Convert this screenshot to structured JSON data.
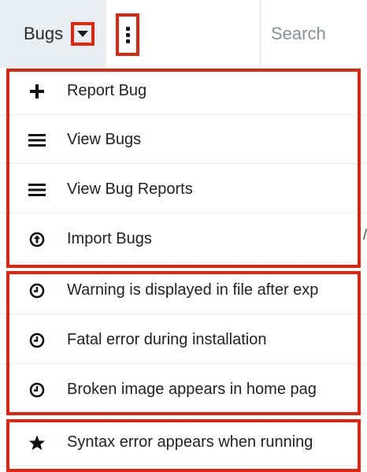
{
  "navbar": {
    "module_label": "Bugs",
    "search_placeholder": "Search"
  },
  "menu": {
    "actions": [
      {
        "label": "Report Bug",
        "icon": "plus-icon"
      },
      {
        "label": "View Bugs",
        "icon": "list-icon"
      },
      {
        "label": "View Bug Reports",
        "icon": "list-icon"
      },
      {
        "label": "Import Bugs",
        "icon": "upload-circle-icon"
      }
    ],
    "recently_viewed": [
      {
        "label": "Warning is displayed in file after exp",
        "icon": "clock-icon"
      },
      {
        "label": "Fatal error during installation",
        "icon": "clock-icon"
      },
      {
        "label": "Broken image appears in home pag",
        "icon": "clock-icon"
      }
    ],
    "favorites": [
      {
        "label": "Syntax error appears when running",
        "icon": "star-icon"
      }
    ]
  },
  "colors": {
    "highlight": "#e1250f",
    "module_tab_bg": "#e9eef3",
    "text": "#222222"
  }
}
